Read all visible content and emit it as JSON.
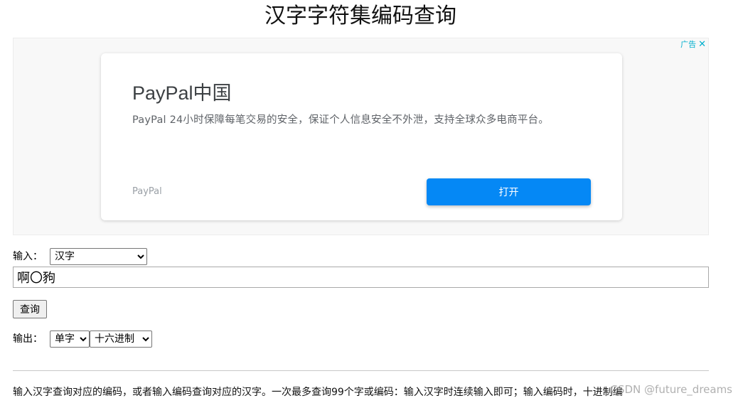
{
  "page": {
    "title": "汉字字符集编码查询"
  },
  "ad": {
    "choices_label": "广告",
    "close_symbol": "✕",
    "headline": "PayPal中国",
    "body": "PayPal 24小时保障每笔交易的安全，保证个人信息安全不外泄，支持全球众多电商平台。",
    "source": "PayPal",
    "button_label": "打开",
    "colors": {
      "button": "#0588f5",
      "choices": "#00aecd"
    }
  },
  "form": {
    "input_label": "输入：",
    "input_type_selected": "汉字",
    "input_value": "啊〇豞",
    "query_button_label": "查询",
    "output_label": "输出：",
    "output_mode_selected": "单字",
    "output_format_selected": "十六进制"
  },
  "footer": {
    "help_text": "输入汉字查询对应的编码，或者输入编码查询对应的汉字。一次最多查询99个字或编码：输入汉字时连续输入即可；输入编码时，十进制编",
    "watermark": "CSDN @future_dreams"
  }
}
